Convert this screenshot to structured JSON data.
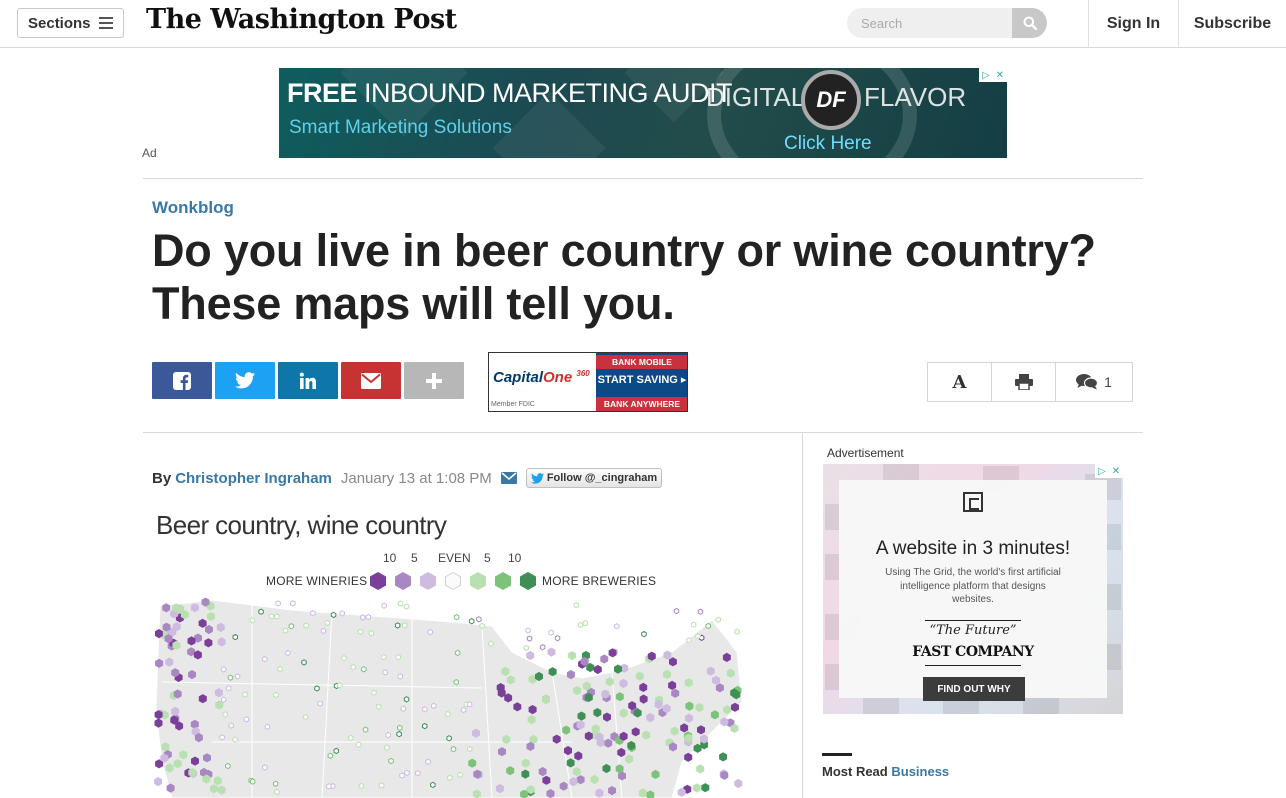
{
  "topbar": {
    "sections_label": "Sections",
    "logo_text": "The Washington Post",
    "search_placeholder": "Search",
    "sign_in_label": "Sign In",
    "subscribe_label": "Subscribe"
  },
  "top_ad": {
    "label": "Ad",
    "free_bold": "FREE",
    "free_rest": " INBOUND MARKETING AUDIT",
    "tagline": "Smart Marketing Solutions",
    "brand_left": "DIGITAL",
    "brand_mark": "DF",
    "brand_right": "FLAVOR",
    "cta": "Click  Here"
  },
  "article": {
    "kicker": "Wonkblog",
    "headline": "Do you live in beer country or wine country? These maps will tell you.",
    "byline_prefix": "By",
    "author": "Christopher Ingraham",
    "date": "January 13 at 1:08 PM",
    "follow_label": "Follow @_cingraham"
  },
  "share": {
    "icons": [
      "facebook-icon",
      "twitter-icon",
      "linkedin-icon",
      "email-icon",
      "plus-icon"
    ],
    "colors": {
      "facebook": "#3b5998",
      "twitter": "#1da1f2",
      "linkedin": "#0e76a8",
      "email": "#c73333",
      "more": "#b7b7b7"
    }
  },
  "inline_ad": {
    "logo_a": "Capital",
    "logo_b": "One",
    "logo_c": "360",
    "band_top": "BANK MOBILE",
    "start": "START SAVING",
    "band_bottom": "BANK ANYWHERE",
    "fdic": "Member FDIC"
  },
  "tools": {
    "font_glyph": "A",
    "comment_count": "1"
  },
  "graphic": {
    "title": "Beer country, wine country",
    "legend_left_label": "MORE WINERIES",
    "legend_right_label": "MORE BREWERIES",
    "legend_numbers": [
      "10",
      "5",
      "EVEN",
      "5",
      "10"
    ],
    "legend_colors": [
      "#7b3f9a",
      "#a987c2",
      "#cdbbe0",
      "#f7f7f7",
      "#b9e0b0",
      "#7cc27a",
      "#3f8f57"
    ]
  },
  "sidebar": {
    "advertisement_label": "Advertisement",
    "ad_headline": "A website in 3 minutes!",
    "ad_sub": "Using The Grid, the world's first artificial intelligence platform that designs websites.",
    "ad_quote": "“The Future”",
    "ad_publisher": "FAST COMPANY",
    "ad_cta": "FIND OUT WHY",
    "most_read_prefix": "Most Read",
    "most_read_section": "Business"
  }
}
